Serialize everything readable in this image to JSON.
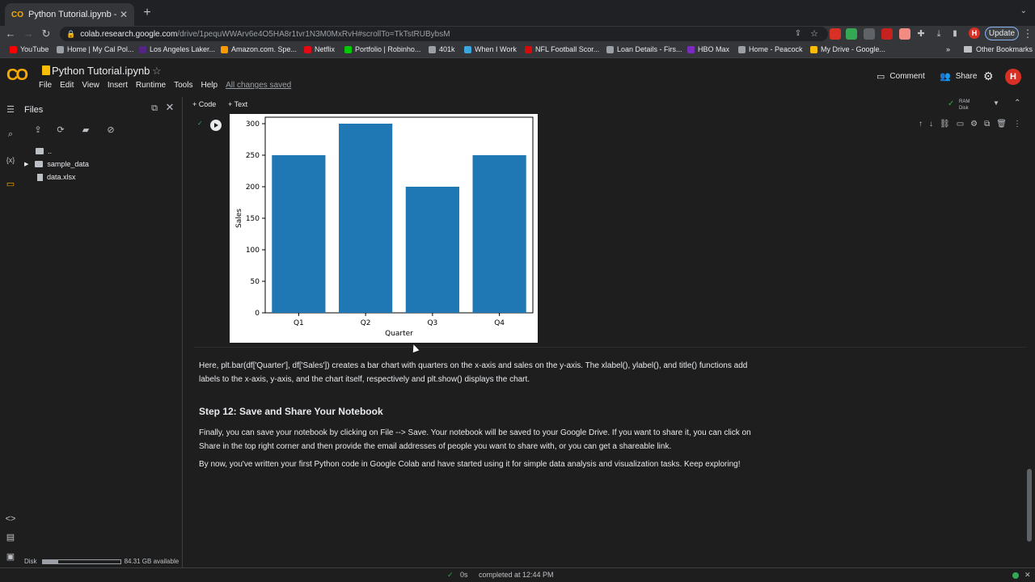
{
  "browser": {
    "tab_title": "Python Tutorial.ipynb - Colab",
    "url_host": "colab.research.google.com",
    "url_path": "/drive/1pequWWArv6e4O5HA8r1tvr1N3M0MxRvH#scrollTo=TkTstRUBybsM",
    "update_label": "Update",
    "profile_initial": "H",
    "bookmarks": [
      {
        "label": "YouTube",
        "color": "#ff0000"
      },
      {
        "label": "Home | My Cal Pol...",
        "color": "#9aa0a6"
      },
      {
        "label": "Los Angeles Laker...",
        "color": "#552583"
      },
      {
        "label": "Amazon.com. Spe...",
        "color": "#ff9900"
      },
      {
        "label": "Netflix",
        "color": "#e50914"
      },
      {
        "label": "Portfolio | Robinho...",
        "color": "#00c805"
      },
      {
        "label": "401k",
        "color": "#9aa0a6"
      },
      {
        "label": "When I Work",
        "color": "#3aa6dd"
      },
      {
        "label": "NFL Football Scor...",
        "color": "#d50a0a"
      },
      {
        "label": "Loan Details - Firs...",
        "color": "#9aa0a6"
      },
      {
        "label": "HBO Max",
        "color": "#7b2cbf"
      },
      {
        "label": "Home - Peacock",
        "color": "#9aa0a6"
      },
      {
        "label": "My Drive - Google...",
        "color": "#fbbc04"
      }
    ],
    "other_bookmarks": "Other Bookmarks"
  },
  "colab": {
    "notebook_title": "Python Tutorial.ipynb",
    "menu": [
      "File",
      "Edit",
      "View",
      "Insert",
      "Runtime",
      "Tools",
      "Help"
    ],
    "saved_status": "All changes saved",
    "comment_label": "Comment",
    "share_label": "Share",
    "user_initial": "H"
  },
  "files_panel": {
    "title": "Files",
    "tree": [
      {
        "name": "..",
        "type": "folder"
      },
      {
        "name": "sample_data",
        "type": "folder"
      },
      {
        "name": "data.xlsx",
        "type": "file"
      }
    ],
    "disk_label": "Disk",
    "disk_available": "84.31 GB available",
    "disk_used_fraction": 0.2
  },
  "toolbar": {
    "add_code": "+ Code",
    "add_text": "+ Text",
    "ram_label": "RAM",
    "disk_label": "Disk"
  },
  "chart_data": {
    "type": "bar",
    "categories": [
      "Q1",
      "Q2",
      "Q3",
      "Q4"
    ],
    "values": [
      250,
      300,
      200,
      250
    ],
    "xlabel": "Quarter",
    "ylabel": "Sales",
    "ylim": [
      0,
      300
    ],
    "yticks": [
      0,
      50,
      100,
      150,
      200,
      250,
      300
    ],
    "bar_color": "#1f77b4"
  },
  "markdown": {
    "para1": "Here, plt.bar(df['Quarter'], df['Sales']) creates a bar chart with quarters on the x-axis and sales on the y-axis. The xlabel(), ylabel(), and title() functions add labels to the x-axis, y-axis, and the chart itself, respectively and plt.show() displays the chart.",
    "heading": "Step 12: Save and Share Your Notebook",
    "para2": "Finally, you can save your notebook by clicking on File --> Save. Your notebook will be saved to your Google Drive. If you want to share it, you can click on Share in the top right corner and then provide the email addresses of people you want to share with, or you can get a shareable link.",
    "para3": "By now, you've written your first Python code in Google Colab and have started using it for simple data analysis and visualization tasks. Keep exploring!"
  },
  "statusbar": {
    "exec_time": "0s",
    "completed": "completed at 12:44 PM"
  }
}
